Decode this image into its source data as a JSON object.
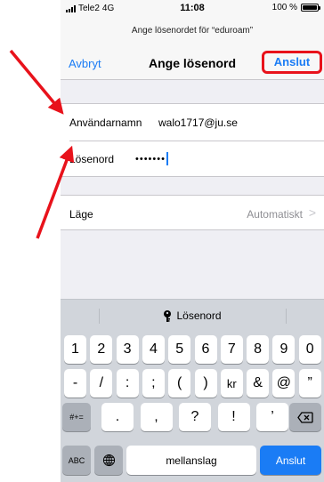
{
  "status": {
    "carrier": "Tele2",
    "network": "4G",
    "time": "11:08",
    "battery": "100 %",
    "battery_level": 1.0
  },
  "prompt": "Ange lösenordet för “eduroam”",
  "nav": {
    "cancel": "Avbryt",
    "title": "Ange lösenord",
    "join": "Anslut"
  },
  "form": {
    "username_label": "Användarnamn",
    "username_value": "walo1717@ju.se",
    "password_label": "Lösenord",
    "password_value": "•••••••",
    "mode_label": "Läge",
    "mode_value": "Automatiskt"
  },
  "keyboard": {
    "suggestion": "Lösenord",
    "row1": [
      "1",
      "2",
      "3",
      "4",
      "5",
      "6",
      "7",
      "8",
      "9",
      "0"
    ],
    "row2": [
      "-",
      "/",
      ":",
      ";",
      "(",
      ")",
      "kr",
      "&",
      "@",
      "”"
    ],
    "row3_mode": "#+=",
    "row3": [
      ".",
      ",",
      "?",
      "!",
      "’"
    ],
    "abc": "ABC",
    "space": "mellanslag",
    "go": "Anslut"
  },
  "colors": {
    "accent": "#1a7cf5",
    "highlight": "#e8121b"
  }
}
